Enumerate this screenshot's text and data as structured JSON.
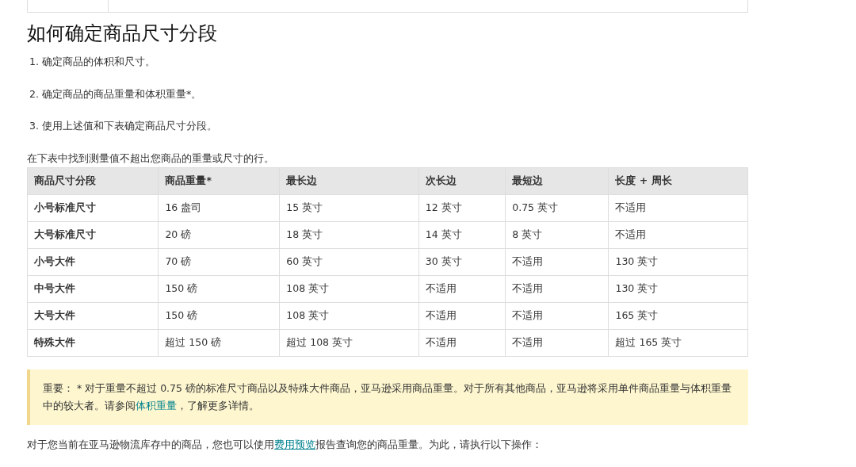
{
  "heading": "如何确定商品尺寸分段",
  "steps": [
    "1. 确定商品的体积和尺寸。",
    "2. 确定商品的商品重量和体积重量*。",
    "3. 使用上述值和下表确定商品尺寸分段。"
  ],
  "intro": "在下表中找到测量值不超出您商品的重量或尺寸的行。",
  "table": {
    "columns": [
      "商品尺寸分段",
      "商品重量*",
      "最长边",
      "次长边",
      "最短边",
      "长度 + 周长"
    ],
    "rows": [
      [
        "小号标准尺寸",
        "16 盎司",
        "15 英寸",
        "12 英寸",
        "0.75 英寸",
        "不适用"
      ],
      [
        "大号标准尺寸",
        "20 磅",
        "18 英寸",
        "14 英寸",
        "8 英寸",
        "不适用"
      ],
      [
        "小号大件",
        "70 磅",
        "60 英寸",
        "30 英寸",
        "不适用",
        "130 英寸"
      ],
      [
        "中号大件",
        "150 磅",
        "108 英寸",
        "不适用",
        "不适用",
        "130 英寸"
      ],
      [
        "大号大件",
        "150 磅",
        "108 英寸",
        "不适用",
        "不适用",
        "165 英寸"
      ],
      [
        "特殊大件",
        "超过 150 磅",
        "超过 108 英寸",
        "不适用",
        "不适用",
        "超过 165 英寸"
      ]
    ]
  },
  "note": {
    "text_before": "重要： * 对于重量不超过 0.75 磅的标准尺寸商品以及特殊大件商品，亚马逊采用商品重量。对于所有其他商品，亚马逊将采用单件商品重量与体积重量中的较大者。请参阅",
    "link": "体积重量",
    "text_after": "，了解更多详情。"
  },
  "footer": {
    "text_before": "对于您当前在亚马逊物流库存中的商品，您也可以使用",
    "link": "费用预览",
    "text_after": "报告查询您的商品重量。为此，请执行以下操作："
  }
}
